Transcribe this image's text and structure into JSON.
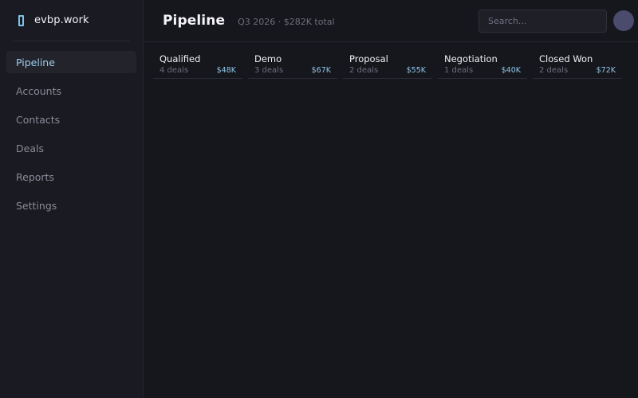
{
  "brand": {
    "name": "evbp.work"
  },
  "sidebar": {
    "items": [
      {
        "label": "Pipeline",
        "active": true
      },
      {
        "label": "Accounts"
      },
      {
        "label": "Contacts"
      },
      {
        "label": "Deals"
      },
      {
        "label": "Reports"
      },
      {
        "label": "Settings"
      }
    ]
  },
  "header": {
    "title": "Pipeline",
    "subtitle": "Q3 2026 · $282K total"
  },
  "search": {
    "placeholder": "Search..."
  },
  "stages": [
    {
      "name": "Qualified",
      "count": "4 deals",
      "value": "$48K"
    },
    {
      "name": "Demo",
      "count": "3 deals",
      "value": "$67K"
    },
    {
      "name": "Proposal",
      "count": "2 deals",
      "value": "$55K"
    },
    {
      "name": "Negotiation",
      "count": "1 deals",
      "value": "$40K"
    },
    {
      "name": "Closed Won",
      "count": "2 deals",
      "value": "$72K"
    }
  ],
  "colors": {
    "accent": "#7cc4e8",
    "background": "#16161d",
    "sidebar": "#1a1a22",
    "avatar": "#4b4b6d"
  }
}
